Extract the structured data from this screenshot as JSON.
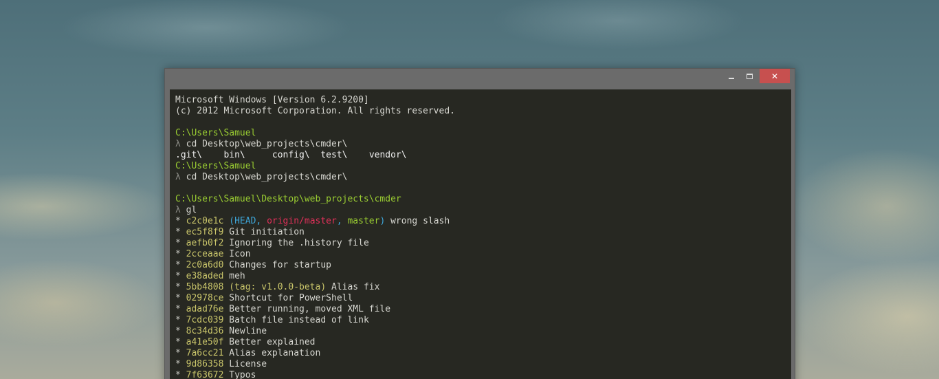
{
  "window": {
    "controls": {
      "minimize": "_",
      "maximize": "□",
      "close": "✕"
    }
  },
  "console": {
    "banner": [
      "Microsoft Windows [Version 6.2.9200]",
      "(c) 2012 Microsoft Corporation. All rights reserved."
    ],
    "prompt_symbol": "λ",
    "session1": {
      "path": "C:\\Users\\Samuel",
      "command": "cd Desktop\\web_projects\\cmder\\",
      "dirs": [
        ".git\\",
        "bin\\",
        "config\\",
        "test\\",
        "vendor\\"
      ]
    },
    "session2": {
      "path": "C:\\Users\\Samuel",
      "command": "cd Desktop\\web_projects\\cmder\\"
    },
    "session3": {
      "path": "C:\\Users\\Samuel\\Desktop\\web_projects\\cmder",
      "command": "gl"
    },
    "git_log": {
      "star": "*",
      "first": {
        "hash": "c2c0e1c",
        "ref_head": "HEAD",
        "ref_remote": "origin/master",
        "ref_local": "master",
        "message": "wrong slash"
      },
      "commits": [
        {
          "hash": "ec5f8f9",
          "message": "Git initiation"
        },
        {
          "hash": "aefb0f2",
          "message": "Ignoring the .history file"
        },
        {
          "hash": "2cceaae",
          "message": "Icon"
        },
        {
          "hash": "2c0a6d0",
          "message": "Changes for startup"
        },
        {
          "hash": "e38aded",
          "message": "meh"
        }
      ],
      "tagged": {
        "hash": "5bb4808",
        "tag": "(tag: v1.0.0-beta)",
        "message": "Alias fix"
      },
      "commits2": [
        {
          "hash": "02978ce",
          "message": "Shortcut for PowerShell"
        },
        {
          "hash": "adad76e",
          "message": "Better running, moved XML file"
        },
        {
          "hash": "7cdc039",
          "message": "Batch file instead of link"
        },
        {
          "hash": "8c34d36",
          "message": "Newline"
        },
        {
          "hash": "a41e50f",
          "message": "Better explained"
        },
        {
          "hash": "7a6cc21",
          "message": "Alias explanation"
        },
        {
          "hash": "9d86358",
          "message": "License"
        },
        {
          "hash": "7f63672",
          "message": "Typos"
        }
      ]
    }
  },
  "colors": {
    "console_bg": "#272822",
    "path_green": "#9acd32",
    "hash_yellow": "#c9c56a",
    "head_blue": "#3ea6d9",
    "remote_red": "#e2305a",
    "close_red": "#c7504f"
  }
}
